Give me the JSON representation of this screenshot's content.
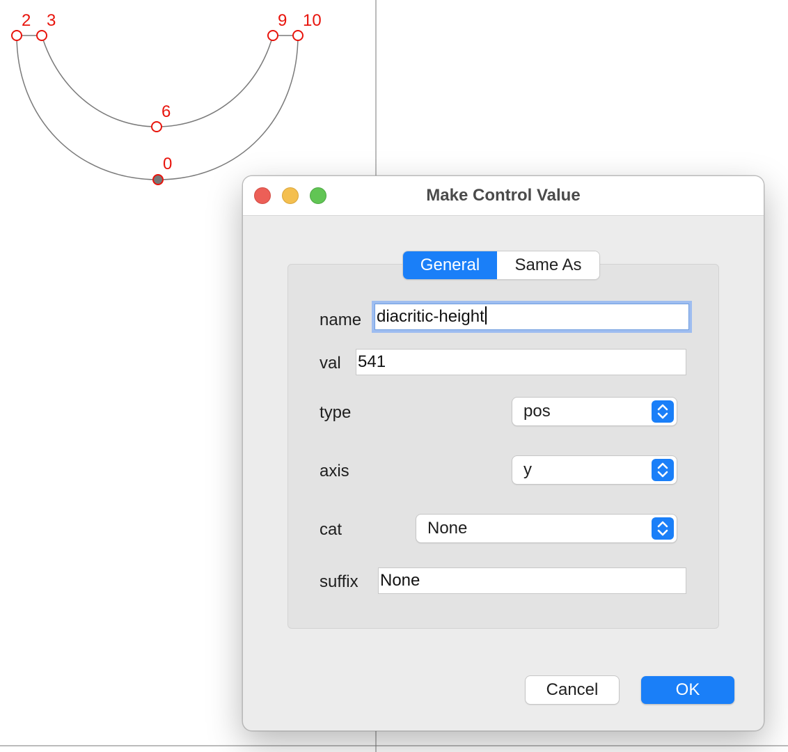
{
  "glyph": {
    "point_labels": [
      "2",
      "3",
      "9",
      "10",
      "6",
      "0"
    ]
  },
  "dialog": {
    "title": "Make Control Value",
    "tabs": [
      {
        "label": "General",
        "selected": true
      },
      {
        "label": "Same As",
        "selected": false
      }
    ],
    "fields": {
      "name_label": "name",
      "name_value": "diacritic-height",
      "val_label": "val",
      "val_value": "541",
      "type_label": "type",
      "type_value": "pos",
      "axis_label": "axis",
      "axis_value": "y",
      "cat_label": "cat",
      "cat_value": "None",
      "suffix_label": "suffix",
      "suffix_value": "None"
    },
    "buttons": {
      "cancel": "Cancel",
      "ok": "OK"
    }
  },
  "colors": {
    "point_marker": "#e8140c",
    "accent": "#1a7ff8"
  }
}
